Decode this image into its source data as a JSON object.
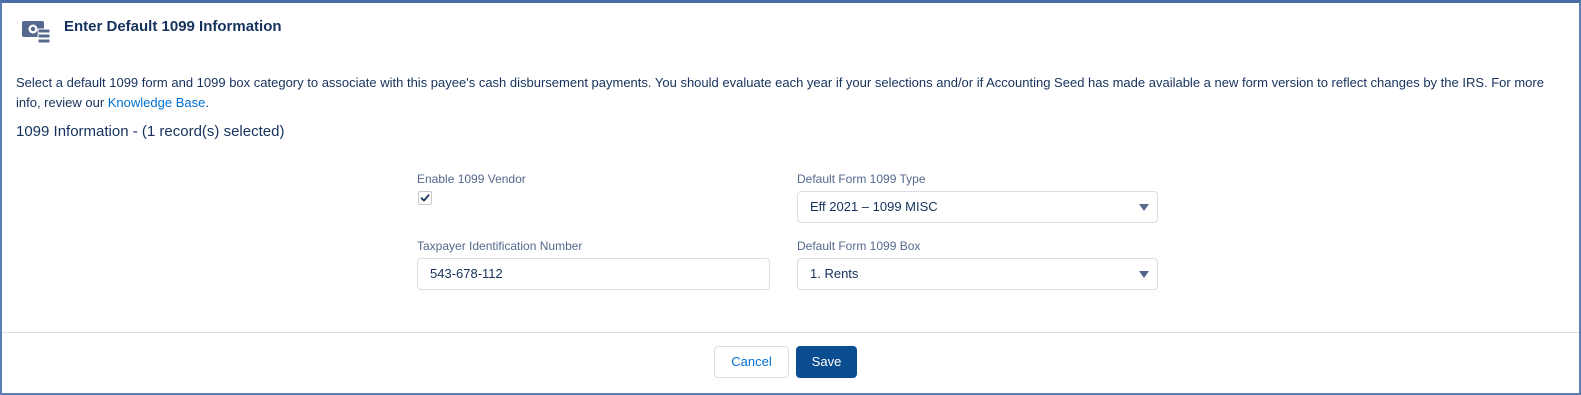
{
  "header": {
    "title": "Enter Default 1099 Information",
    "icon": "cash-disbursement-icon"
  },
  "description": {
    "text": "Select a default 1099 form and 1099 box category to associate with this payee's cash disbursement payments. You should evaluate each year if your selections and/or if Accounting Seed has made available a new form version to reflect changes by the IRS. For more info, review our ",
    "link_text": "Knowledge Base",
    "suffix": "."
  },
  "section": {
    "title": "1099 Information - (1 record(s) selected)"
  },
  "form": {
    "enable_vendor": {
      "label": "Enable 1099 Vendor",
      "checked": true
    },
    "form_type": {
      "label": "Default Form 1099 Type",
      "value": "Eff 2021 – 1099 MISC"
    },
    "tin": {
      "label": "Taxpayer Identification Number",
      "value": "543-678-112"
    },
    "form_box": {
      "label": "Default Form 1099 Box",
      "value": "1. Rents"
    }
  },
  "footer": {
    "cancel_label": "Cancel",
    "save_label": "Save"
  },
  "colors": {
    "brand_blue": "#0b4d91",
    "link_blue": "#0070d2",
    "text": "#16325c",
    "label": "#54698d",
    "border": "#d8dde6"
  }
}
